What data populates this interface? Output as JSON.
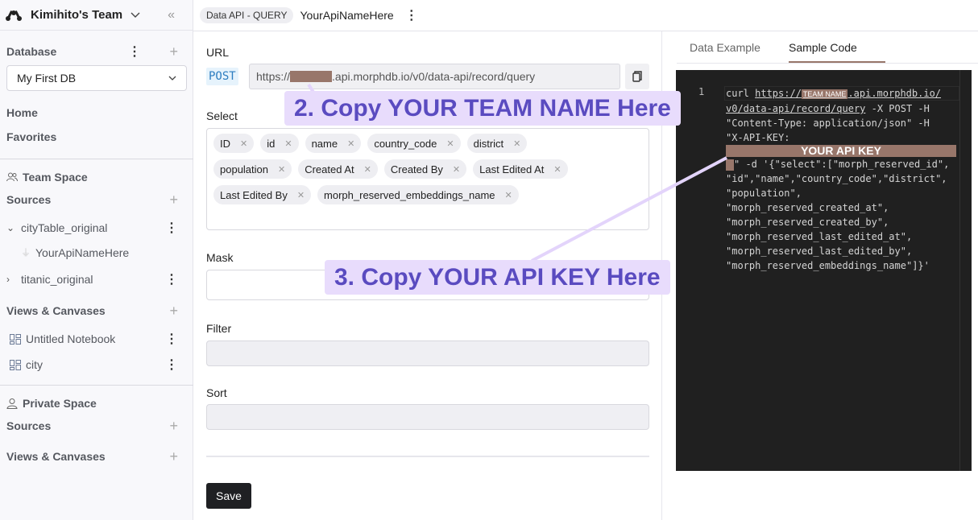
{
  "sidebar": {
    "team_name": "Kimihito's Team",
    "database_label": "Database",
    "database_selected": "My First DB",
    "nav": [
      "Home",
      "Favorites"
    ],
    "team_space": {
      "label": "Team Space",
      "sources_label": "Sources",
      "sources": [
        {
          "name": "cityTable_original",
          "expanded": true,
          "children": [
            "YourApiNameHere"
          ]
        },
        {
          "name": "titanic_original",
          "expanded": false
        }
      ],
      "views_label": "Views & Canvases",
      "views": [
        "Untitled Notebook",
        "city"
      ]
    },
    "private_space": {
      "label": "Private Space",
      "sources_label": "Sources",
      "views_label": "Views & Canvases"
    }
  },
  "header": {
    "badge": "Data API - QUERY",
    "api_name": "YourApiNameHere"
  },
  "form": {
    "url_label": "URL",
    "method": "POST",
    "url_prefix": "https://",
    "url_suffix": ".api.morphdb.io/v0/data-api/record/query",
    "select_label": "Select",
    "select_rows": [
      [
        "ID",
        "id",
        "name",
        "country_code",
        "district"
      ],
      [
        "population",
        "Created At",
        "Created By",
        "Last Edited At"
      ],
      [
        "Last Edited By",
        "morph_reserved_embeddings_name"
      ]
    ],
    "mask_label": "Mask",
    "mask_value": "",
    "filter_label": "Filter",
    "sort_label": "Sort",
    "save_label": "Save"
  },
  "right_panel": {
    "tabs": [
      "Data Example",
      "Sample Code"
    ],
    "active_tab": "Sample Code",
    "line_number": "1",
    "code": {
      "l1_a": "curl ",
      "l1_b": "https://",
      "team_tag": "TEAM NAME",
      "l1_c": ".api.morphdb.io/",
      "l2_a": "v0/data-api/record/query",
      "l2_b": " -X POST -H",
      "l3": "\"Content-Type: application/json\" -H",
      "l4": "\"X-API-KEY:",
      "api_key_tag": "YOUR API KEY",
      "l6": "\" -d '{\"select\":[\"morph_reserved_id\",",
      "l7": "\"id\",\"name\",\"country_code\",\"district\",",
      "l8": "\"population\",",
      "l9": "\"morph_reserved_created_at\",",
      "l10": "\"morph_reserved_created_by\",",
      "l11": "\"morph_reserved_last_edited_at\",",
      "l12": "\"morph_reserved_last_edited_by\",",
      "l13": "\"morph_reserved_embeddings_name\"]}'"
    }
  },
  "annotations": {
    "team_name_callout": "2. Copy YOUR TEAM NAME Here",
    "api_key_callout": "3. Copy YOUR API KEY Here",
    "callout_color": "#e8dcfc",
    "callout_text_color": "#5a4bc0",
    "redaction_color": "#98766a"
  }
}
